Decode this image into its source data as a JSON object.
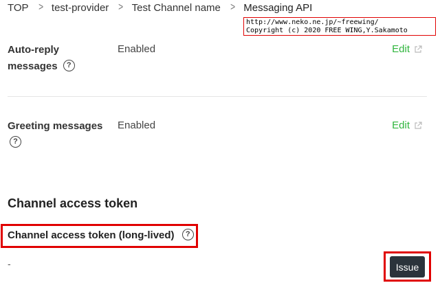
{
  "breadcrumb": {
    "items": [
      {
        "label": "TOP"
      },
      {
        "label": "test-provider"
      },
      {
        "label": "Test Channel name"
      },
      {
        "label": "Messaging API"
      }
    ]
  },
  "watermark": {
    "line1": "http://www.neko.ne.jp/~freewing/",
    "line2": "Copyright (c) 2020 FREE WING,Y.Sakamoto"
  },
  "settings": [
    {
      "label_line1": "Auto-reply",
      "label_line2": "messages",
      "value": "Enabled",
      "action": "Edit"
    },
    {
      "label_line1": "Greeting messages",
      "value": "Enabled",
      "action": "Edit"
    }
  ],
  "help_glyph": "?",
  "channel_access_token": {
    "section_title": "Channel access token",
    "subtitle": "Channel access token (long-lived)",
    "value": "-",
    "issue_label": "Issue"
  },
  "colors": {
    "accent_green": "#2fb53d",
    "highlight_red": "#e00000",
    "button_dark": "#2b333b"
  },
  "icons": [
    "chevron-right-icon",
    "external-link-icon",
    "help-circle-icon"
  ]
}
